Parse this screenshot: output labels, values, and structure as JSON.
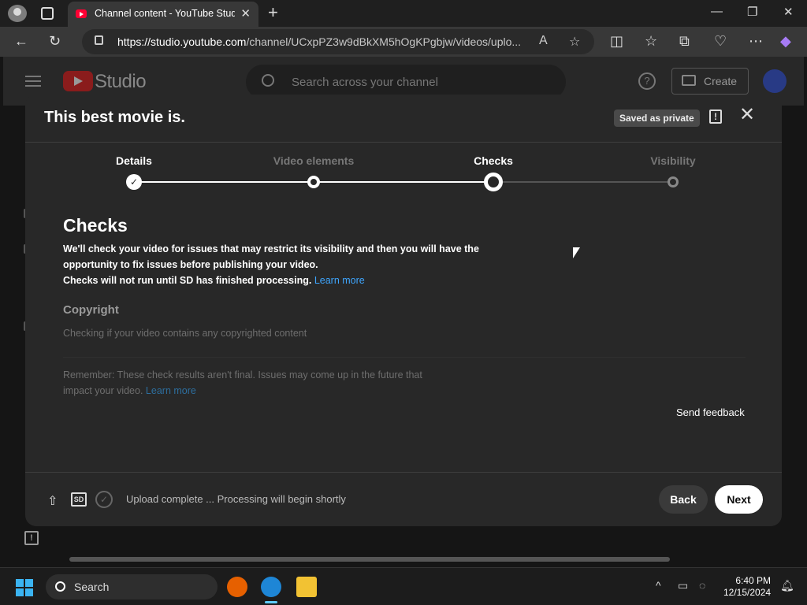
{
  "browser": {
    "tab_title": "Channel content - YouTube Studio",
    "url_host": "https://studio.youtube.com",
    "url_path": "/channel/UCxpPZ3w9dBkXM5hOgKPgbjw/videos/uplo..."
  },
  "studio_header": {
    "logo_text": "Studio",
    "search_placeholder": "Search across your channel",
    "create_label": "Create"
  },
  "dialog": {
    "title": "This best movie is.",
    "saved_badge": "Saved as private",
    "steps": [
      {
        "label": "Details",
        "state": "done"
      },
      {
        "label": "Video elements",
        "state": "done"
      },
      {
        "label": "Checks",
        "state": "current"
      },
      {
        "label": "Visibility",
        "state": "pending"
      }
    ],
    "heading": "Checks",
    "description_line1": "We'll check your video for issues that may restrict its visibility and then you will have the opportunity to fix issues before publishing your video.",
    "description_line2": "Checks will not run until SD has finished processing.",
    "learn_more": "Learn more",
    "copyright_heading": "Copyright",
    "copyright_status": "Checking if your video contains any copyrighted content",
    "remember_text": "Remember: These check results aren't final. Issues may come up in the future that impact your video.",
    "remember_link": "Learn more",
    "send_feedback": "Send feedback",
    "footer": {
      "sd_badge": "SD",
      "status": "Upload complete ... Processing will begin shortly",
      "back": "Back",
      "next": "Next"
    }
  },
  "taskbar": {
    "search_label": "Search",
    "time": "6:40 PM",
    "date": "12/15/2024"
  },
  "colors": {
    "link": "#3ea6ff",
    "dialog_bg": "#282828",
    "youtube_red": "#ff0033"
  }
}
